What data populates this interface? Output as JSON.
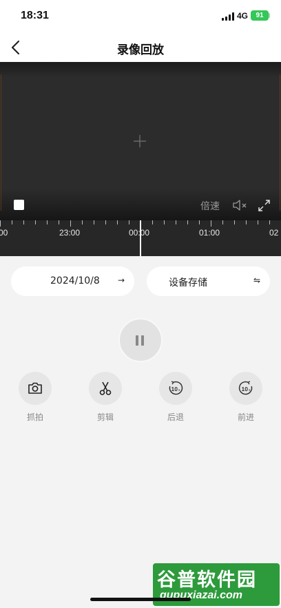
{
  "status_bar": {
    "time": "18:31",
    "network": "4G",
    "battery": "91"
  },
  "nav": {
    "title": "录像回放"
  },
  "player": {
    "speed_label": "倍速"
  },
  "timeline": {
    "labels": [
      "00",
      "23:00",
      "00:00",
      "01:00",
      "02"
    ]
  },
  "filters": {
    "date": "2024/10/8",
    "date_arrow": "→",
    "storage": "设备存储",
    "storage_arrow": "⇋"
  },
  "actions": [
    {
      "label": "抓拍",
      "icon": "camera-icon"
    },
    {
      "label": "剪辑",
      "icon": "scissors-icon"
    },
    {
      "label": "后退",
      "icon": "rewind-10-icon"
    },
    {
      "label": "前进",
      "icon": "forward-10-icon"
    }
  ],
  "watermark": {
    "title": "谷普软件园",
    "url": "gupuxiazai.com"
  },
  "colors": {
    "battery": "#34c759",
    "watermark": "#2d9a3b"
  }
}
